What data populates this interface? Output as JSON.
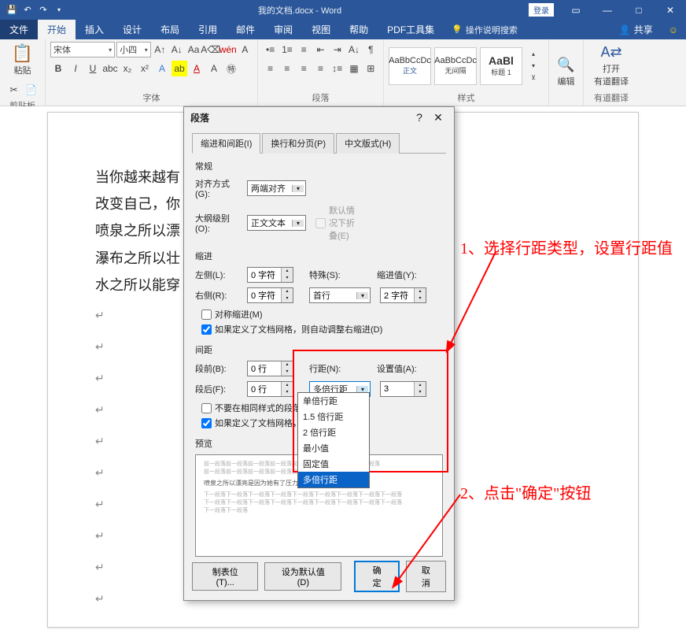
{
  "titlebar": {
    "doc_title": "我的文档.docx - Word",
    "login": "登录"
  },
  "tabs": {
    "file": "文件",
    "home": "开始",
    "insert": "插入",
    "design": "设计",
    "layout": "布局",
    "references": "引用",
    "mailings": "邮件",
    "review": "审阅",
    "view": "视图",
    "help": "帮助",
    "pdf": "PDF工具集",
    "search_placeholder": "操作说明搜索",
    "share": "共享"
  },
  "ribbon": {
    "paste": "粘贴",
    "clipboard": "剪贴板",
    "font_name": "宋体",
    "font_size": "小四",
    "font_group": "字体",
    "paragraph_group": "段落",
    "styles_group": "样式",
    "style1_preview": "AaBbCcDc",
    "style1_name": "正文",
    "style2_preview": "AaBbCcDc",
    "style2_name": "无间隔",
    "style3_preview": "AaBl",
    "style3_name": "标题 1",
    "edit": "编辑",
    "translate1": "打开",
    "translate2": "有道翻译",
    "translate_group": "有道翻译"
  },
  "document": {
    "line1": "当你越来越有",
    "line2": "改变自己，你",
    "line3": "喷泉之所以漂",
    "line4": "瀑布之所以壮",
    "line5": "水之所以能穿"
  },
  "dialog": {
    "title": "段落",
    "tab1": "缩进和间距(I)",
    "tab2": "换行和分页(P)",
    "tab3": "中文版式(H)",
    "general": "常规",
    "alignment_label": "对齐方式(G):",
    "alignment_value": "两端对齐",
    "outline_label": "大纲级别(O):",
    "outline_value": "正文文本",
    "collapse": "默认情况下折叠(E)",
    "indent": "缩进",
    "left_label": "左侧(L):",
    "left_value": "0 字符",
    "right_label": "右侧(R):",
    "right_value": "0 字符",
    "special_label": "特殊(S):",
    "indent_by_label": "缩进值(Y):",
    "special_value": "首行",
    "indent_by_value": "2 字符",
    "mirror": "对称缩进(M)",
    "auto_adjust": "如果定义了文档网格，则自动调整右缩进(D)",
    "spacing": "间距",
    "before_label": "段前(B):",
    "before_value": "0 行",
    "after_label": "段后(F):",
    "after_value": "0 行",
    "line_spacing_label": "行距(N):",
    "set_value_label": "设置值(A):",
    "line_spacing_value": "多倍行距",
    "set_value": "3",
    "no_space_same": "不要在相同样式的段落间增加",
    "snap_grid": "如果定义了文档网格，则对齐",
    "preview": "预览",
    "dropdown_options": [
      "单倍行距",
      "1.5 倍行距",
      "2 倍行距",
      "最小值",
      "固定值",
      "多倍行距"
    ],
    "tabs_btn": "制表位(T)...",
    "default_btn": "设为默认值(D)",
    "ok": "确定",
    "cancel": "取消"
  },
  "annotations": {
    "a1": "1、选择行距类型，设置行距值",
    "a2": "2、点击\"确定\"按钮"
  }
}
